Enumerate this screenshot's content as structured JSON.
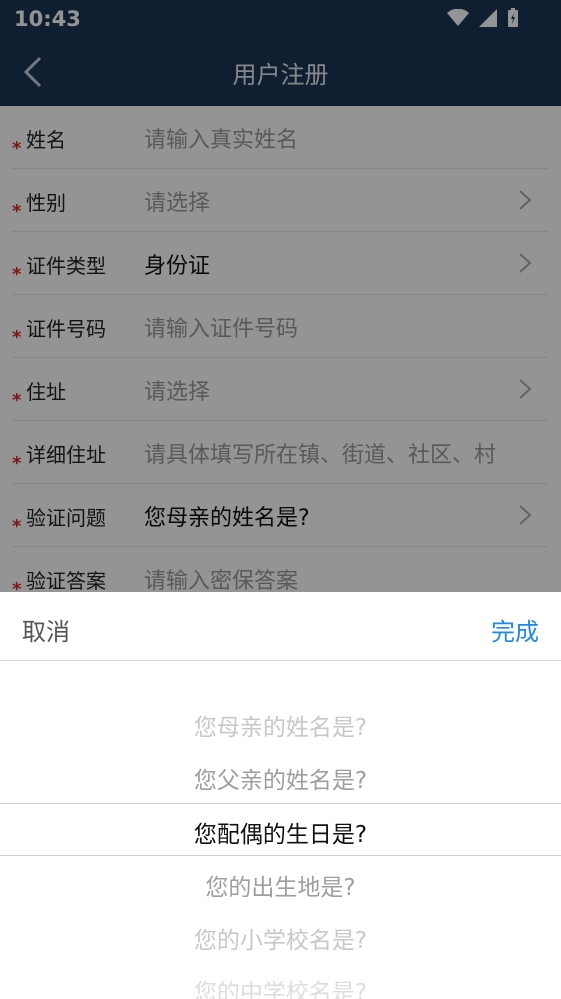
{
  "status": {
    "time": "10:43"
  },
  "header": {
    "title": "用户注册"
  },
  "form": {
    "rows": [
      {
        "label": "姓名",
        "value": "请输入真实姓名",
        "placeholder": true,
        "chevron": false
      },
      {
        "label": "性别",
        "value": "请选择",
        "placeholder": true,
        "chevron": true
      },
      {
        "label": "证件类型",
        "value": "身份证",
        "placeholder": false,
        "chevron": true
      },
      {
        "label": "证件号码",
        "value": "请输入证件号码",
        "placeholder": true,
        "chevron": false
      },
      {
        "label": "住址",
        "value": "请选择",
        "placeholder": true,
        "chevron": true
      },
      {
        "label": "详细住址",
        "value": "请具体填写所在镇、街道、社区、村",
        "placeholder": true,
        "chevron": false
      },
      {
        "label": "验证问题",
        "value": "您母亲的姓名是?",
        "placeholder": false,
        "chevron": true
      },
      {
        "label": "验证答案",
        "value": "请输入密保答案",
        "placeholder": true,
        "chevron": false
      }
    ]
  },
  "picker": {
    "cancel_label": "取消",
    "done_label": "完成",
    "options": [
      "您母亲的姓名是?",
      "您父亲的姓名是?",
      "您配偶的生日是?",
      "您的出生地是?",
      "您的小学校名是?",
      "您的中学校名是?"
    ],
    "selected_index": 2
  },
  "colors": {
    "header": "#1d3557",
    "accent": "#1e88e5",
    "required": "#d62828"
  }
}
